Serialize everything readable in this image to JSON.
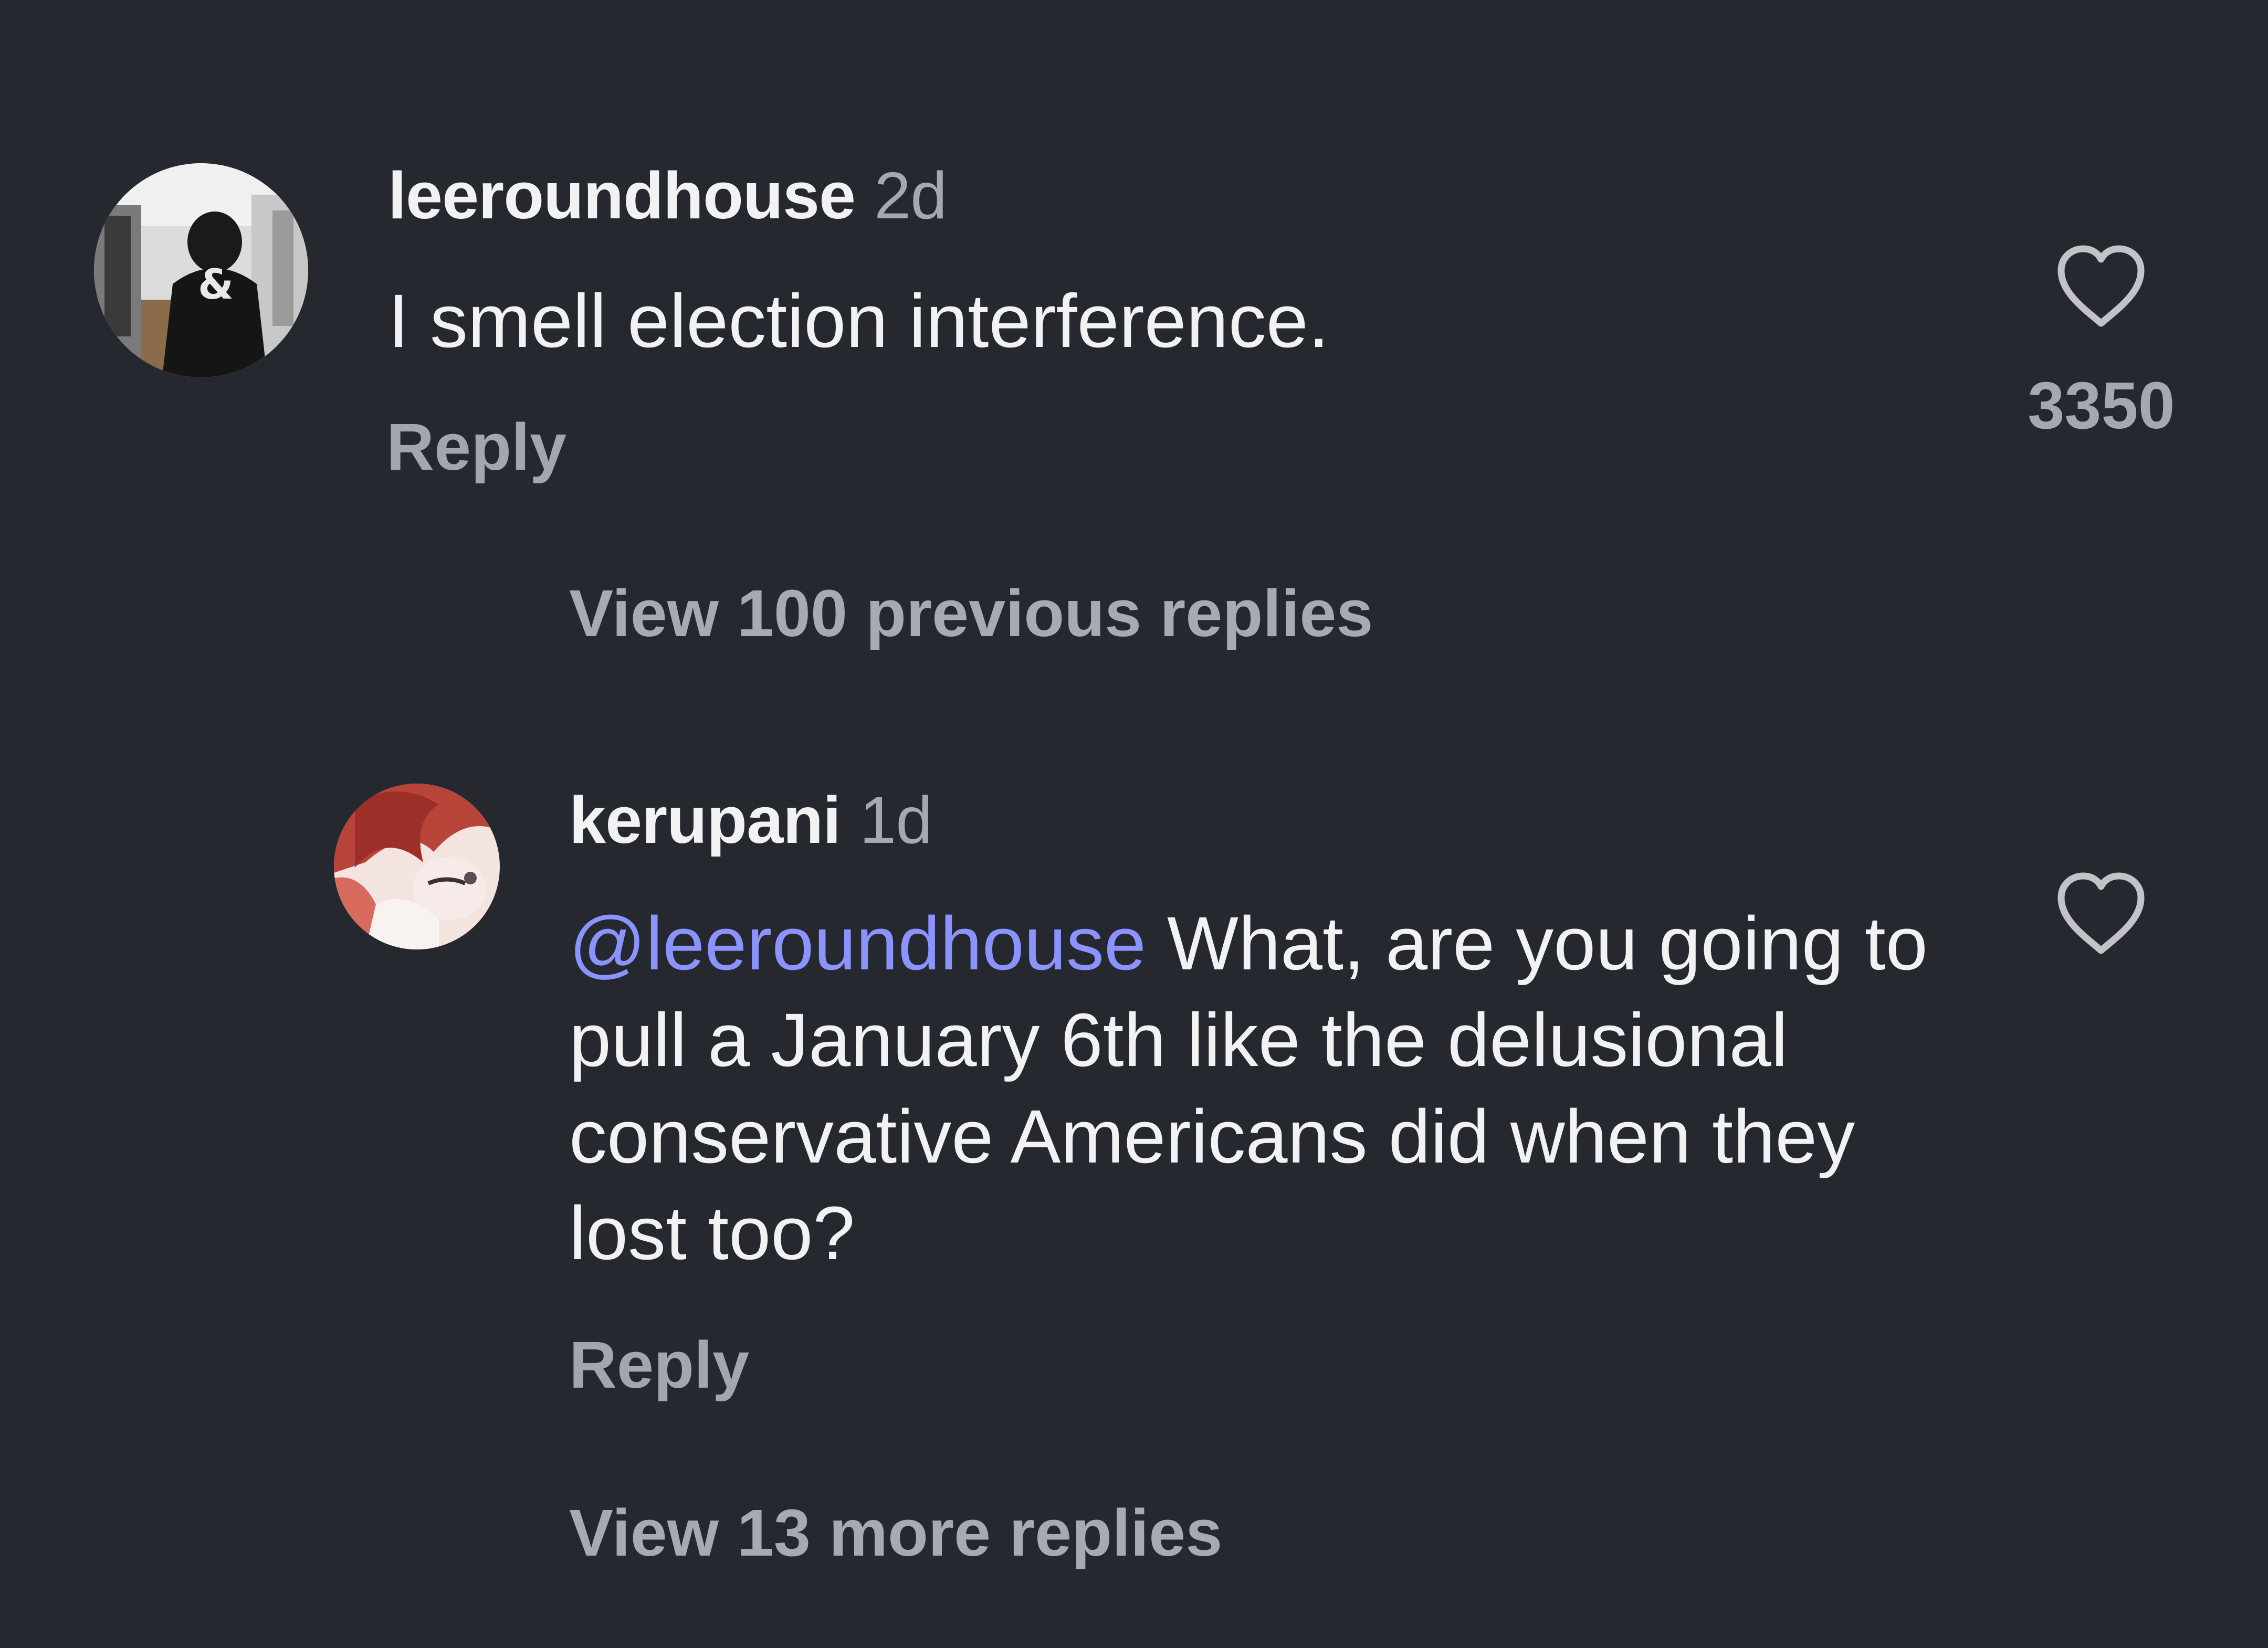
{
  "comments": [
    {
      "username": "leeroundhouse",
      "time": "2d",
      "text": "I smell election interference.",
      "reply_label": "Reply",
      "like_count": "3350",
      "avatar_icon": "avatar-photo",
      "avatar_glyph": "&",
      "heart_icon": "heart-outline-icon"
    },
    {
      "username": "kerupani",
      "time": "1d",
      "mention": "@leeroundhouse",
      "text": "What, are you going to pull a January 6th like the delusional conservative Americans did when they lost too?",
      "reply_label": "Reply",
      "avatar_icon": "avatar-photo",
      "heart_icon": "heart-outline-icon"
    }
  ],
  "view_previous_label": "View 100 previous replies",
  "view_more_label": "View 13 more replies",
  "colors": {
    "background": "#262830",
    "text": "#f2f2f4",
    "muted": "#a6a8b1",
    "mention": "#8b93ff"
  }
}
